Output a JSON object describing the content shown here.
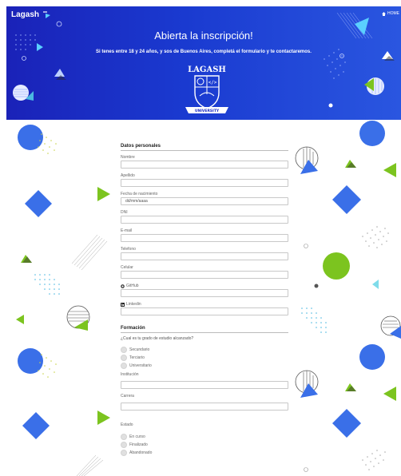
{
  "header": {
    "brand": "Lagash",
    "home_link": "HOME",
    "title": "Abierta la inscripción!",
    "subtitle": "Si tenes entre 18 y 24 años, y sos de Buenos Aires, completá el formulario y te contactaremos.",
    "emblem": {
      "top": "LAGASH",
      "bottom": "UNIVERSITY"
    }
  },
  "form": {
    "personal": {
      "title": "Datos personales",
      "fields": [
        {
          "label": "Nombre",
          "value": ""
        },
        {
          "label": "Apellido",
          "value": ""
        },
        {
          "label": "Fecha de nacimiento",
          "value": "dd/mm/aaaa"
        },
        {
          "label": "DNI",
          "value": ""
        },
        {
          "label": "E-mail",
          "value": ""
        },
        {
          "label": "Telefono",
          "value": ""
        },
        {
          "label": "Celular",
          "value": ""
        },
        {
          "label": "GitHub",
          "icon": "github-icon",
          "value": ""
        },
        {
          "label": "Linkedin",
          "icon": "linkedin-icon",
          "value": ""
        }
      ]
    },
    "education": {
      "title": "Formación",
      "question": "¿Cual es tu grado de estudio alcanzado?",
      "level_options": [
        "Secundario",
        "Terciario",
        "Universitario"
      ],
      "institution_label": "Institución",
      "career_label": "Carrera",
      "status_label": "Estado",
      "status_options": [
        "En curso",
        "Finalizado",
        "Abandonado"
      ]
    }
  },
  "colors": {
    "hero": "#1a2bc4",
    "blue": "#3a6fe8",
    "green": "#7cc41f",
    "cyan": "#4ab8e0"
  }
}
